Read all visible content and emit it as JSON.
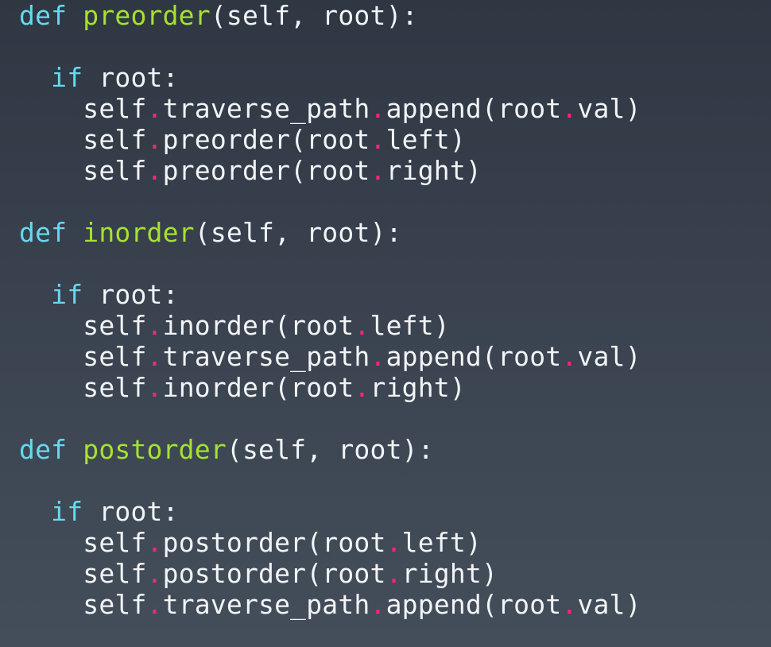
{
  "editor": {
    "colors": {
      "keyword": "#66d9ef",
      "function": "#a6e22e",
      "dot": "#f92672",
      "text": "#f2f4f7",
      "background_top": "#2f3743",
      "background_bottom": "#444e5b"
    },
    "lines": [
      [
        {
          "t": "kw",
          "v": "def"
        },
        {
          "t": "txt",
          "v": " "
        },
        {
          "t": "fn",
          "v": "preorder"
        },
        {
          "t": "txt",
          "v": "(self, root):"
        }
      ],
      [],
      [
        {
          "t": "txt",
          "v": "  "
        },
        {
          "t": "kw",
          "v": "if"
        },
        {
          "t": "txt",
          "v": " root:"
        }
      ],
      [
        {
          "t": "txt",
          "v": "    self"
        },
        {
          "t": "dot",
          "v": "."
        },
        {
          "t": "txt",
          "v": "traverse_path"
        },
        {
          "t": "dot",
          "v": "."
        },
        {
          "t": "txt",
          "v": "append(root"
        },
        {
          "t": "dot",
          "v": "."
        },
        {
          "t": "txt",
          "v": "val)"
        }
      ],
      [
        {
          "t": "txt",
          "v": "    self"
        },
        {
          "t": "dot",
          "v": "."
        },
        {
          "t": "txt",
          "v": "preorder(root"
        },
        {
          "t": "dot",
          "v": "."
        },
        {
          "t": "txt",
          "v": "left)"
        }
      ],
      [
        {
          "t": "txt",
          "v": "    self"
        },
        {
          "t": "dot",
          "v": "."
        },
        {
          "t": "txt",
          "v": "preorder(root"
        },
        {
          "t": "dot",
          "v": "."
        },
        {
          "t": "txt",
          "v": "right)"
        }
      ],
      [],
      [
        {
          "t": "kw",
          "v": "def"
        },
        {
          "t": "txt",
          "v": " "
        },
        {
          "t": "fn",
          "v": "inorder"
        },
        {
          "t": "txt",
          "v": "(self, root):"
        }
      ],
      [],
      [
        {
          "t": "txt",
          "v": "  "
        },
        {
          "t": "kw",
          "v": "if"
        },
        {
          "t": "txt",
          "v": " root:"
        }
      ],
      [
        {
          "t": "txt",
          "v": "    self"
        },
        {
          "t": "dot",
          "v": "."
        },
        {
          "t": "txt",
          "v": "inorder(root"
        },
        {
          "t": "dot",
          "v": "."
        },
        {
          "t": "txt",
          "v": "left)"
        }
      ],
      [
        {
          "t": "txt",
          "v": "    self"
        },
        {
          "t": "dot",
          "v": "."
        },
        {
          "t": "txt",
          "v": "traverse_path"
        },
        {
          "t": "dot",
          "v": "."
        },
        {
          "t": "txt",
          "v": "append(root"
        },
        {
          "t": "dot",
          "v": "."
        },
        {
          "t": "txt",
          "v": "val)"
        }
      ],
      [
        {
          "t": "txt",
          "v": "    self"
        },
        {
          "t": "dot",
          "v": "."
        },
        {
          "t": "txt",
          "v": "inorder(root"
        },
        {
          "t": "dot",
          "v": "."
        },
        {
          "t": "txt",
          "v": "right)"
        }
      ],
      [],
      [
        {
          "t": "kw",
          "v": "def"
        },
        {
          "t": "txt",
          "v": " "
        },
        {
          "t": "fn",
          "v": "postorder"
        },
        {
          "t": "txt",
          "v": "(self, root):"
        }
      ],
      [],
      [
        {
          "t": "txt",
          "v": "  "
        },
        {
          "t": "kw",
          "v": "if"
        },
        {
          "t": "txt",
          "v": " root:"
        }
      ],
      [
        {
          "t": "txt",
          "v": "    self"
        },
        {
          "t": "dot",
          "v": "."
        },
        {
          "t": "txt",
          "v": "postorder(root"
        },
        {
          "t": "dot",
          "v": "."
        },
        {
          "t": "txt",
          "v": "left)"
        }
      ],
      [
        {
          "t": "txt",
          "v": "    self"
        },
        {
          "t": "dot",
          "v": "."
        },
        {
          "t": "txt",
          "v": "postorder(root"
        },
        {
          "t": "dot",
          "v": "."
        },
        {
          "t": "txt",
          "v": "right)"
        }
      ],
      [
        {
          "t": "txt",
          "v": "    self"
        },
        {
          "t": "dot",
          "v": "."
        },
        {
          "t": "txt",
          "v": "traverse_path"
        },
        {
          "t": "dot",
          "v": "."
        },
        {
          "t": "txt",
          "v": "append(root"
        },
        {
          "t": "dot",
          "v": "."
        },
        {
          "t": "txt",
          "v": "val)"
        }
      ]
    ]
  }
}
